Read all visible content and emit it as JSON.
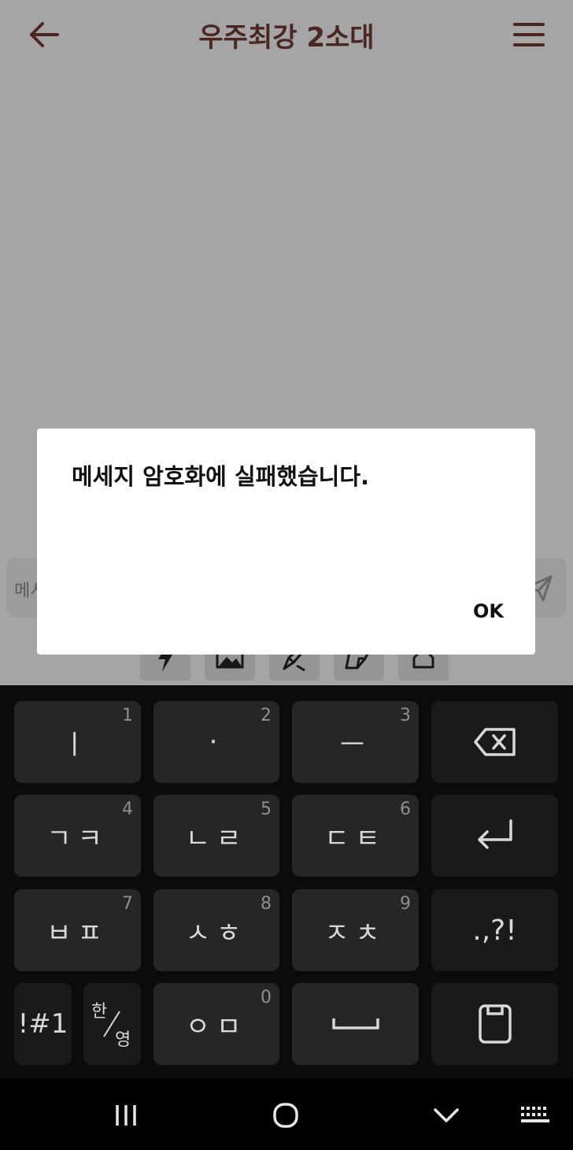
{
  "header": {
    "title": "우주최강 2소대"
  },
  "input": {
    "placeholder": "메시"
  },
  "dialog": {
    "message": "메세지 암호화에 실패했습니다.",
    "ok_label": "OK"
  },
  "keyboard": {
    "rows": [
      [
        {
          "label": "ㅣ",
          "num": "1"
        },
        {
          "label": "·",
          "num": "2"
        },
        {
          "label": "ㅡ",
          "num": "3"
        }
      ],
      [
        {
          "label": "ㄱㅋ",
          "num": "4"
        },
        {
          "label": "ㄴㄹ",
          "num": "5"
        },
        {
          "label": "ㄷㅌ",
          "num": "6"
        }
      ],
      [
        {
          "label": "ㅂㅍ",
          "num": "7"
        },
        {
          "label": "ㅅㅎ",
          "num": "8"
        },
        {
          "label": "ㅈㅊ",
          "num": "9"
        }
      ]
    ],
    "punct_label": ".,?!",
    "symbols_label": "!#1",
    "lang_top": "한",
    "lang_bottom": "영",
    "om_label": "ㅇㅁ",
    "om_num": "0"
  },
  "colors": {
    "title": "#6e3a34",
    "key_bg": "#262626",
    "keyboard_bg": "#0b0b0b"
  },
  "icons": [
    "arrow-left-icon",
    "hamburger-menu-icon",
    "send-icon",
    "lightning-icon",
    "image-icon",
    "pen-icon",
    "sticker-icon",
    "home-icon",
    "backspace-icon",
    "enter-icon",
    "space-icon",
    "clipboard-icon",
    "recent-apps-icon",
    "home-circle-icon",
    "chevron-down-icon",
    "keyboard-icon"
  ]
}
